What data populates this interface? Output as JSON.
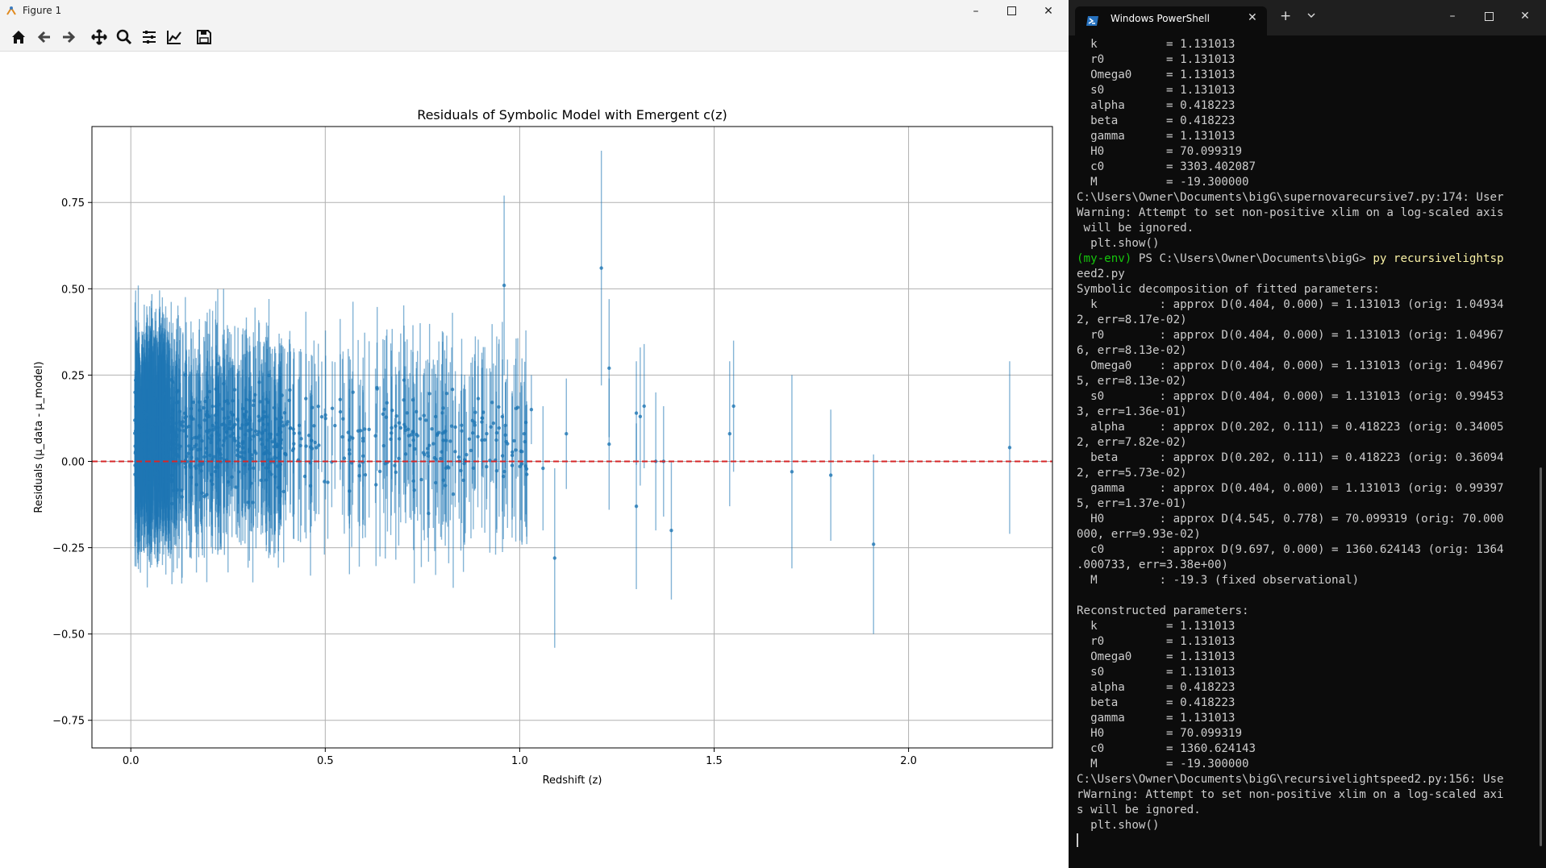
{
  "figure_window": {
    "title": "Figure 1",
    "toolbar": [
      "home-icon",
      "back-arrow-icon",
      "forward-arrow-icon",
      "pan-icon",
      "zoom-icon",
      "subplots-config-icon",
      "edit-axis-icon",
      "save-icon"
    ]
  },
  "chart_data": {
    "type": "scatter",
    "title": "Residuals of Symbolic Model with Emergent c(z)",
    "xlabel": "Redshift (z)",
    "ylabel": "Residuals (μ_data - μ_model)",
    "xlim": [
      -0.1,
      2.37
    ],
    "ylim": [
      -0.83,
      0.97
    ],
    "xticks": [
      "0.0",
      "0.5",
      "1.0",
      "1.5",
      "2.0"
    ],
    "xtick_values": [
      0.0,
      0.5,
      1.0,
      1.5,
      2.0
    ],
    "yticks": [
      "0.75",
      "0.50",
      "0.25",
      "0.00",
      "−0.25",
      "−0.50",
      "−0.75"
    ],
    "ytick_values": [
      0.75,
      0.5,
      0.25,
      0.0,
      -0.25,
      -0.5,
      -0.75
    ],
    "grid": true,
    "zero_line": {
      "y": 0,
      "color": "#d62728",
      "style": "dashed"
    },
    "marker_color": "#1f77b4",
    "series": [
      {
        "name": "",
        "points_sparse": [
          {
            "x": 0.96,
            "y": 0.51,
            "err": 0.26
          },
          {
            "x": 1.03,
            "y": 0.15,
            "err": 0.1
          },
          {
            "x": 1.06,
            "y": -0.02,
            "err": 0.18
          },
          {
            "x": 1.09,
            "y": -0.28,
            "err": 0.26
          },
          {
            "x": 1.12,
            "y": 0.08,
            "err": 0.16
          },
          {
            "x": 1.21,
            "y": 0.56,
            "err": 0.34
          },
          {
            "x": 1.23,
            "y": 0.27,
            "err": 0.2
          },
          {
            "x": 1.23,
            "y": 0.05,
            "err": 0.19
          },
          {
            "x": 1.3,
            "y": 0.14,
            "err": 0.15
          },
          {
            "x": 1.3,
            "y": -0.13,
            "err": 0.24
          },
          {
            "x": 1.31,
            "y": 0.13,
            "err": 0.2
          },
          {
            "x": 1.32,
            "y": 0.16,
            "err": 0.18
          },
          {
            "x": 1.35,
            "y": 0.0,
            "err": 0.2
          },
          {
            "x": 1.37,
            "y": 0.0,
            "err": 0.16
          },
          {
            "x": 1.39,
            "y": -0.2,
            "err": 0.2
          },
          {
            "x": 1.54,
            "y": 0.08,
            "err": 0.21
          },
          {
            "x": 1.55,
            "y": 0.16,
            "err": 0.19
          },
          {
            "x": 1.7,
            "y": -0.03,
            "err": 0.28
          },
          {
            "x": 1.8,
            "y": -0.04,
            "err": 0.19
          },
          {
            "x": 1.91,
            "y": -0.24,
            "err": 0.26
          },
          {
            "x": 2.26,
            "y": 0.04,
            "err": 0.25
          }
        ]
      }
    ]
  },
  "terminal": {
    "tab_title": "Windows PowerShell",
    "lines": [
      "  k          = 1.131013",
      "  r0         = 1.131013",
      "  Omega0     = 1.131013",
      "  s0         = 1.131013",
      "  alpha      = 0.418223",
      "  beta       = 0.418223",
      "  gamma      = 1.131013",
      "  H0         = 70.099319",
      "  c0         = 3303.402087",
      "  M          = -19.300000",
      "C:\\Users\\Owner\\Documents\\bigG\\supernovarecursive7.py:174: User",
      "Warning: Attempt to set non-positive xlim on a log-scaled axis",
      " will be ignored.",
      "  plt.show()",
      "",
      "eed2.py",
      "Symbolic decomposition of fitted parameters:",
      "  k         : approx D(0.404, 0.000) = 1.131013 (orig: 1.04934",
      "2, err=8.17e-02)",
      "  r0        : approx D(0.404, 0.000) = 1.131013 (orig: 1.04967",
      "6, err=8.13e-02)",
      "  Omega0    : approx D(0.404, 0.000) = 1.131013 (orig: 1.04967",
      "5, err=8.13e-02)",
      "  s0        : approx D(0.404, 0.000) = 1.131013 (orig: 0.99453",
      "3, err=1.36e-01)",
      "  alpha     : approx D(0.202, 0.111) = 0.418223 (orig: 0.34005",
      "2, err=7.82e-02)",
      "  beta      : approx D(0.202, 0.111) = 0.418223 (orig: 0.36094",
      "2, err=5.73e-02)",
      "  gamma     : approx D(0.404, 0.000) = 1.131013 (orig: 0.99397",
      "5, err=1.37e-01)",
      "  H0        : approx D(4.545, 0.778) = 70.099319 (orig: 70.000",
      "000, err=9.93e-02)",
      "  c0        : approx D(9.697, 0.000) = 1360.624143 (orig: 1364",
      ".000733, err=3.38e+00)",
      "  M         : -19.3 (fixed observational)",
      "",
      "Reconstructed parameters:",
      "  k          = 1.131013",
      "  r0         = 1.131013",
      "  Omega0     = 1.131013",
      "  s0         = 1.131013",
      "  alpha      = 0.418223",
      "  beta       = 0.418223",
      "  gamma      = 1.131013",
      "  H0         = 70.099319",
      "  c0         = 1360.624143",
      "  M          = -19.300000",
      "C:\\Users\\Owner\\Documents\\bigG\\recursivelightspeed2.py:156: Use",
      "rWarning: Attempt to set non-positive xlim on a log-scaled axi",
      "s will be ignored.",
      "  plt.show()"
    ],
    "prompt_env": "(my-env)",
    "prompt_path": " PS C:\\Users\\Owner\\Documents\\bigG> ",
    "prompt_cmd": "py recursivelightsp"
  }
}
